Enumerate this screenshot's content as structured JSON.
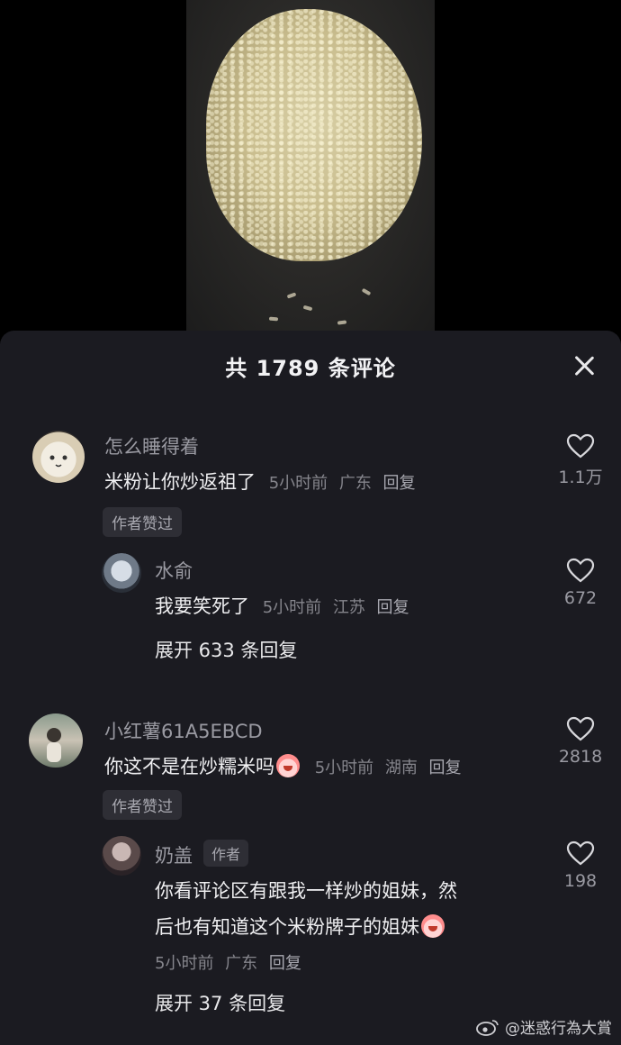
{
  "header": {
    "title": "共 1789 条评论"
  },
  "comments": [
    {
      "username": "怎么睡得着",
      "text": "米粉让你炒返祖了",
      "time": "5小时前",
      "location": "广东",
      "reply_label": "回复",
      "likes": "1.1万",
      "badge": "作者赞过",
      "reply": {
        "username": "水俞",
        "text": "我要笑死了",
        "time": "5小时前",
        "location": "江苏",
        "reply_label": "回复",
        "likes": "672"
      },
      "expand": "展开 633 条回复"
    },
    {
      "username": "小红薯61A5EBCD",
      "text": "你这不是在炒糯米吗",
      "time": "5小时前",
      "location": "湖南",
      "reply_label": "回复",
      "likes": "2818",
      "badge": "作者赞过",
      "reply": {
        "username": "奶盖",
        "author_tag": "作者",
        "text_line1": "你看评论区有跟我一样炒的姐妹，然",
        "text_line2": "后也有知道这个米粉牌子的姐妹",
        "time": "5小时前",
        "location": "广东",
        "reply_label": "回复",
        "likes": "198"
      },
      "expand": "展开 37 条回复"
    }
  ],
  "watermark": {
    "text": "@迷惑行為大賞"
  },
  "colors": {
    "sheet_bg": "#1b1b21",
    "muted": "#9a9aa2",
    "badge_bg": "#2e2e35"
  }
}
